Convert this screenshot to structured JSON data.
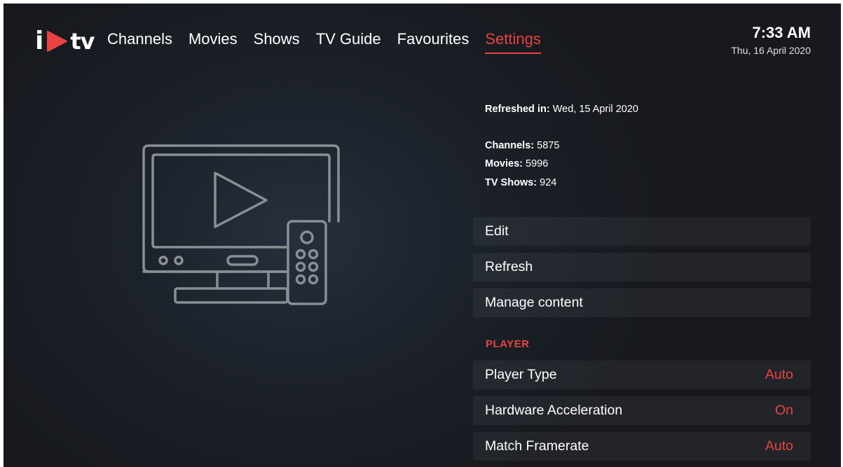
{
  "brand": {
    "name": "iPTV",
    "prefix": "i",
    "suffix": "tv",
    "accent_color": "#e8433f"
  },
  "nav": {
    "items": [
      {
        "label": "Channels"
      },
      {
        "label": "Movies"
      },
      {
        "label": "Shows"
      },
      {
        "label": "TV Guide"
      },
      {
        "label": "Favourites"
      },
      {
        "label": "Settings",
        "active": true
      }
    ]
  },
  "clock": {
    "time": "7:33 AM",
    "date": "Thu, 16 April 2020"
  },
  "info": {
    "refreshed_label": "Refreshed in:",
    "refreshed_value": "Wed, 15 April 2020",
    "channels_label": "Channels:",
    "channels_value": "5875",
    "movies_label": "Movies:",
    "movies_value": "5996",
    "shows_label": "TV Shows:",
    "shows_value": "924"
  },
  "actions": [
    {
      "label": "Edit"
    },
    {
      "label": "Refresh"
    },
    {
      "label": "Manage content"
    }
  ],
  "player_section": {
    "title": "PLAYER",
    "settings": [
      {
        "label": "Player Type",
        "value": "Auto"
      },
      {
        "label": "Hardware Acceleration",
        "value": "On"
      },
      {
        "label": "Match Framerate",
        "value": "Auto"
      }
    ]
  },
  "illustration": {
    "icon": "tv-with-remote-icon"
  }
}
